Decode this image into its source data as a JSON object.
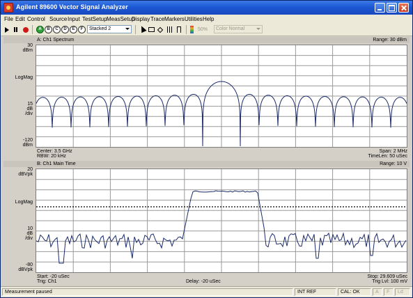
{
  "window": {
    "title": "Agilent 89600 Vector Signal Analyzer"
  },
  "menu": [
    "File",
    "Edit",
    "Control",
    "Source",
    "Input",
    "TestSetup",
    "MeasSetup",
    "Display",
    "Trace",
    "Markers",
    "Utilities",
    "Help"
  ],
  "toolbar": {
    "circle_buttons": [
      "A",
      "B",
      "C",
      "D",
      "E",
      "F"
    ],
    "layout_select": "Stacked 2",
    "percent_label": "50%",
    "color_select": "Color Normal"
  },
  "colors": {
    "trace": "#1a2a6a",
    "reference_line": "#c00000",
    "grid": "#999999",
    "title_bar": "#1d58d4"
  },
  "traceA": {
    "title": "A: Ch1 Spectrum",
    "range": "Range: 30 dBm",
    "y_top": "30",
    "y_top_unit": "dBm",
    "y_mid": "LogMag",
    "y_scale": "15",
    "y_scale_unit1": "dB",
    "y_scale_unit2": "/div",
    "y_bottom": "-120",
    "y_bottom_unit": "dBm",
    "foot_left_1": "Center: 3.5 GHz",
    "foot_left_2": "RBW: 20 kHz",
    "foot_right_1": "Span: 2 MHz",
    "foot_right_2": "TimeLen: 50 uSec"
  },
  "traceB": {
    "title": "B: Ch1 Main Time",
    "range": "Range: 10 V",
    "y_top": "20",
    "y_top_unit": "dBVpk",
    "y_mid": "LogMag",
    "y_scale": "10",
    "y_scale_unit1": "dB",
    "y_scale_unit2": "/div",
    "y_bottom": "-80",
    "y_bottom_unit": "dBVpk",
    "foot_left_1": "Start: -20 uSec",
    "foot_left_2": "Trig: Ch1",
    "foot_center": "Delay: -20 uSec",
    "foot_right_1": "Stop: 29.609 uSec",
    "foot_right_2": "Trig Lvl: 100 mV"
  },
  "status": {
    "message": "Measurement paused",
    "ref": "INT REF",
    "cal": "CAL: OK",
    "ind1": "A",
    "ind2": "F",
    "ind3": "Ld"
  }
}
